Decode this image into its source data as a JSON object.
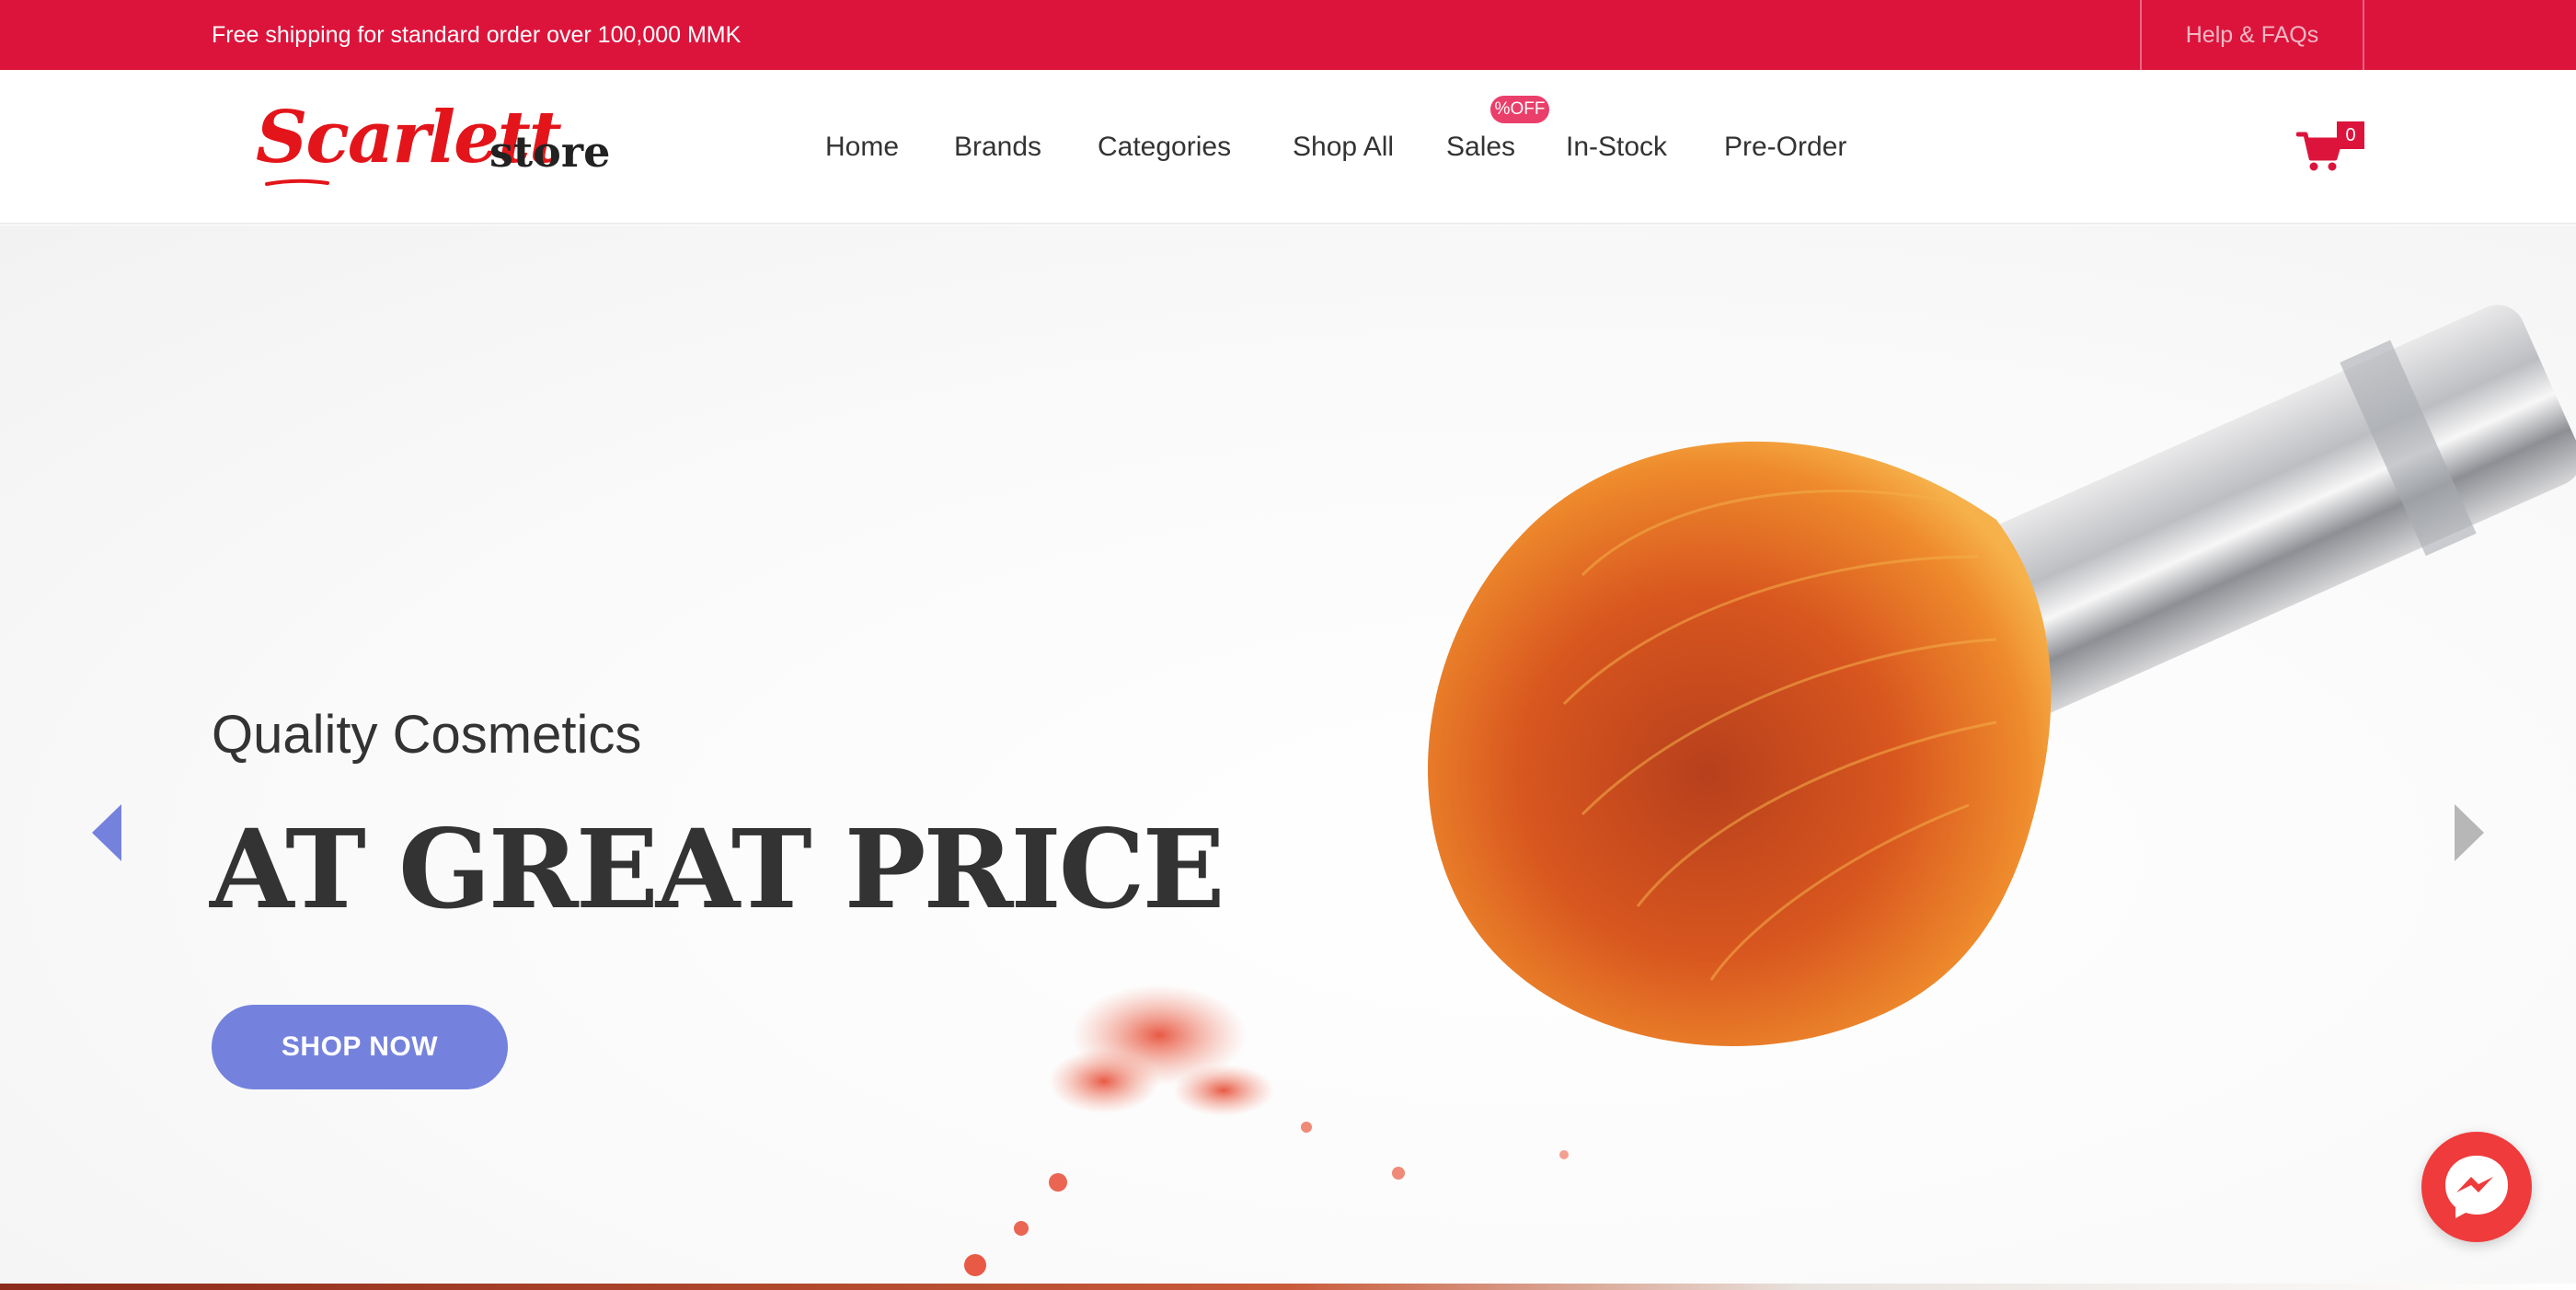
{
  "topbar": {
    "shipping_text": "Free shipping for standard order over 100,000 MMK",
    "help_label": "Help & FAQs"
  },
  "brand": {
    "logo_script": "Scarlett",
    "logo_store": "store"
  },
  "nav": {
    "items": [
      {
        "label": "Home"
      },
      {
        "label": "Brands"
      },
      {
        "label": "Categories"
      },
      {
        "label": "Shop All"
      },
      {
        "label": "Sales",
        "badge": "%OFF"
      },
      {
        "label": "In-Stock"
      },
      {
        "label": "Pre-Order"
      }
    ]
  },
  "cart": {
    "count": "0",
    "icon": "cart-icon"
  },
  "hero": {
    "subtitle": "Quality Cosmetics",
    "headline": "AT GREAT PRICE",
    "cta_label": "SHOP NOW",
    "prev_icon": "chevron-left-icon",
    "next_icon": "chevron-right-icon"
  },
  "chat": {
    "icon": "messenger-icon"
  },
  "colors": {
    "brand_red": "#dc143c",
    "cta_blue": "#7482de",
    "badge_pink": "#ea3f6a",
    "messenger_red": "#ef3b3b"
  }
}
